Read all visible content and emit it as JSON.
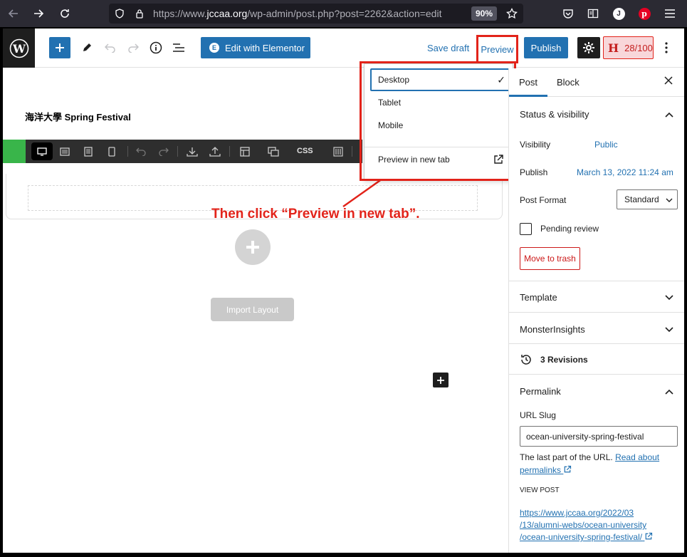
{
  "browser": {
    "url_prefix": "https://www.",
    "url_domain": "jccaa.org",
    "url_path": "/wp-admin/post.php?post=2262&action=edit",
    "zoom": "90%",
    "avatar_letter": "J"
  },
  "toolbar": {
    "elementor_label": "Edit with Elementor",
    "save_draft_label": "Save draft",
    "preview_label": "Preview",
    "publish_label": "Publish",
    "score_label": "28/100",
    "score_letter": "H"
  },
  "editor": {
    "post_title": "海洋大學 Spring Festival",
    "css_label": "CSS",
    "import_label": "Import Layout",
    "annotation": "Then click “Preview in new tab”."
  },
  "preview_menu": {
    "desktop": "Desktop",
    "tablet": "Tablet",
    "mobile": "Mobile",
    "new_tab": "Preview in new tab"
  },
  "sidebar": {
    "tab_post": "Post",
    "tab_block": "Block",
    "status_title": "Status & visibility",
    "visibility_label": "Visibility",
    "visibility_value": "Public",
    "publish_label": "Publish",
    "publish_value": "March 13, 2022 11:24 am",
    "format_label": "Post Format",
    "format_value": "Standard",
    "pending_label": "Pending review",
    "trash_label": "Move to trash",
    "template_title": "Template",
    "monster_title": "MonsterInsights",
    "revisions_label": "3 Revisions",
    "permalink_title": "Permalink",
    "slug_label": "URL Slug",
    "slug_value": "ocean-university-spring-festival",
    "url_help": "The last part of the URL.",
    "read_about": "Read about",
    "permalinks": "permalinks",
    "view_post_label": "VIEW POST",
    "view_line1": "https://www.jccaa.org/2022/03",
    "view_line2": "/13/alumni-webs/ocean-university",
    "view_line3": "/ocean-university-spring-festival/"
  },
  "colors": {
    "accent": "#2271b1",
    "annotation_red": "#e2231a",
    "elementor_green": "#39b54a"
  }
}
